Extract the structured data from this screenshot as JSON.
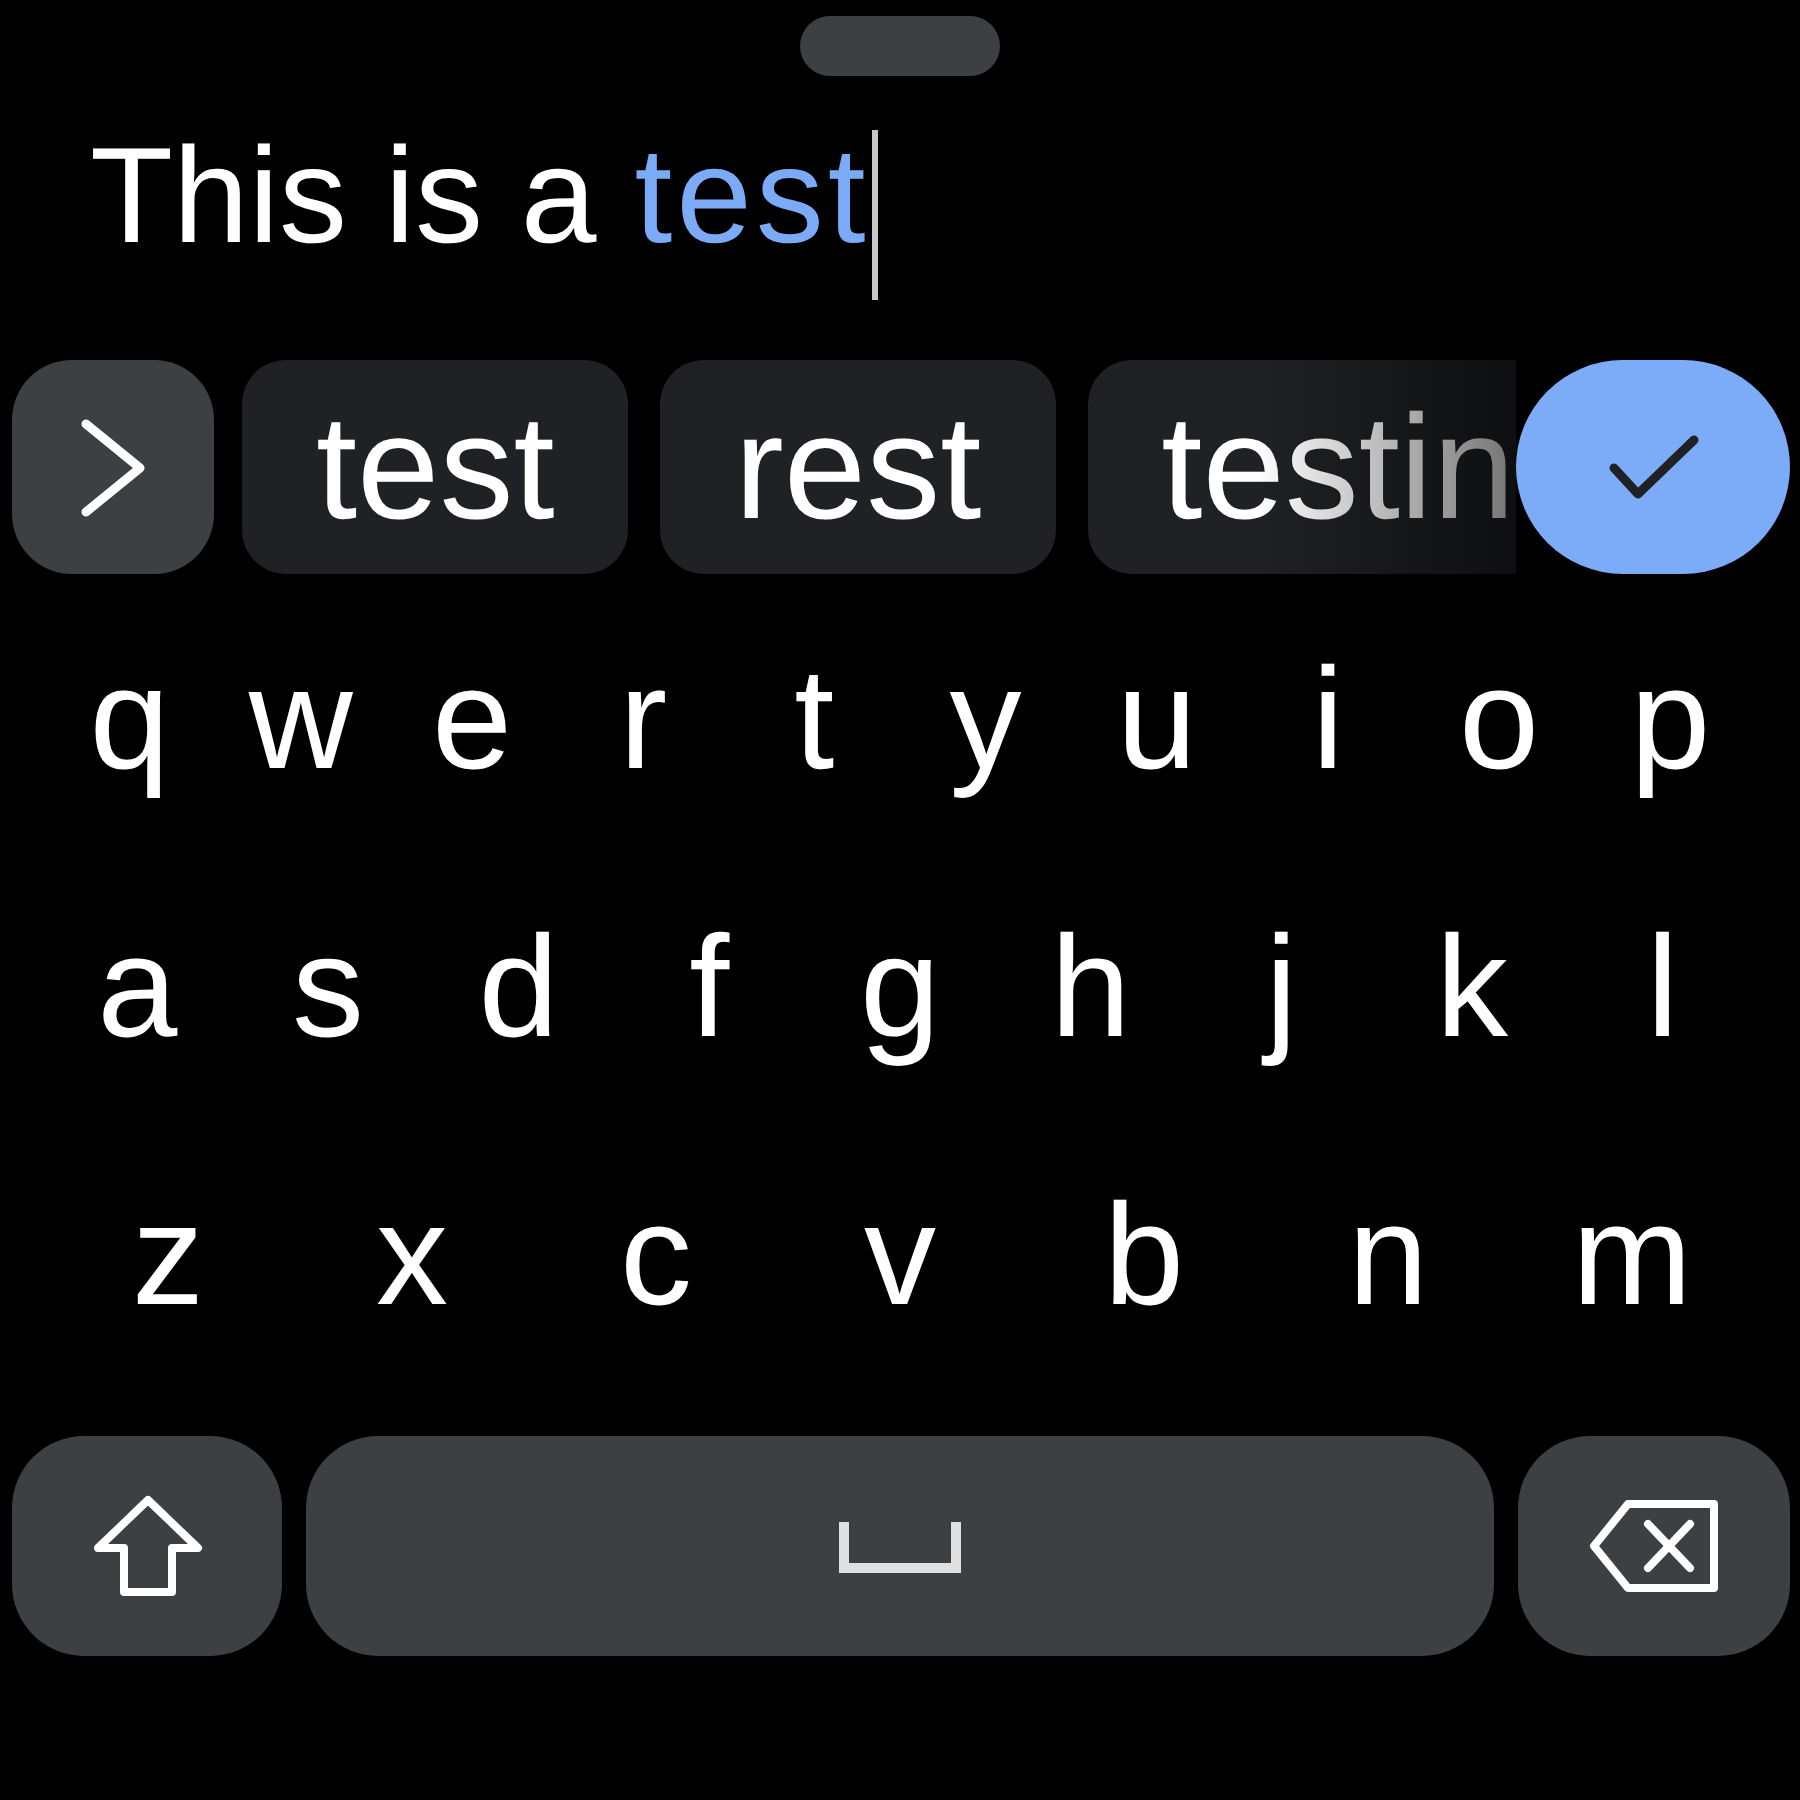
{
  "input": {
    "value": "This is a",
    "composing": "test"
  },
  "suggestions": [
    "test",
    "rest",
    "testin"
  ],
  "keyboard": {
    "top_row": [
      "q",
      "w",
      "e",
      "r",
      "t",
      "y",
      "u",
      "i",
      "o",
      "p"
    ],
    "middle_row": [
      "a",
      "s",
      "d",
      "f",
      "g",
      "h",
      "j",
      "k",
      "l"
    ],
    "bottom_row": [
      "z",
      "x",
      "c",
      "v",
      "b",
      "n",
      "m"
    ],
    "shift": {
      "on": false
    }
  }
}
